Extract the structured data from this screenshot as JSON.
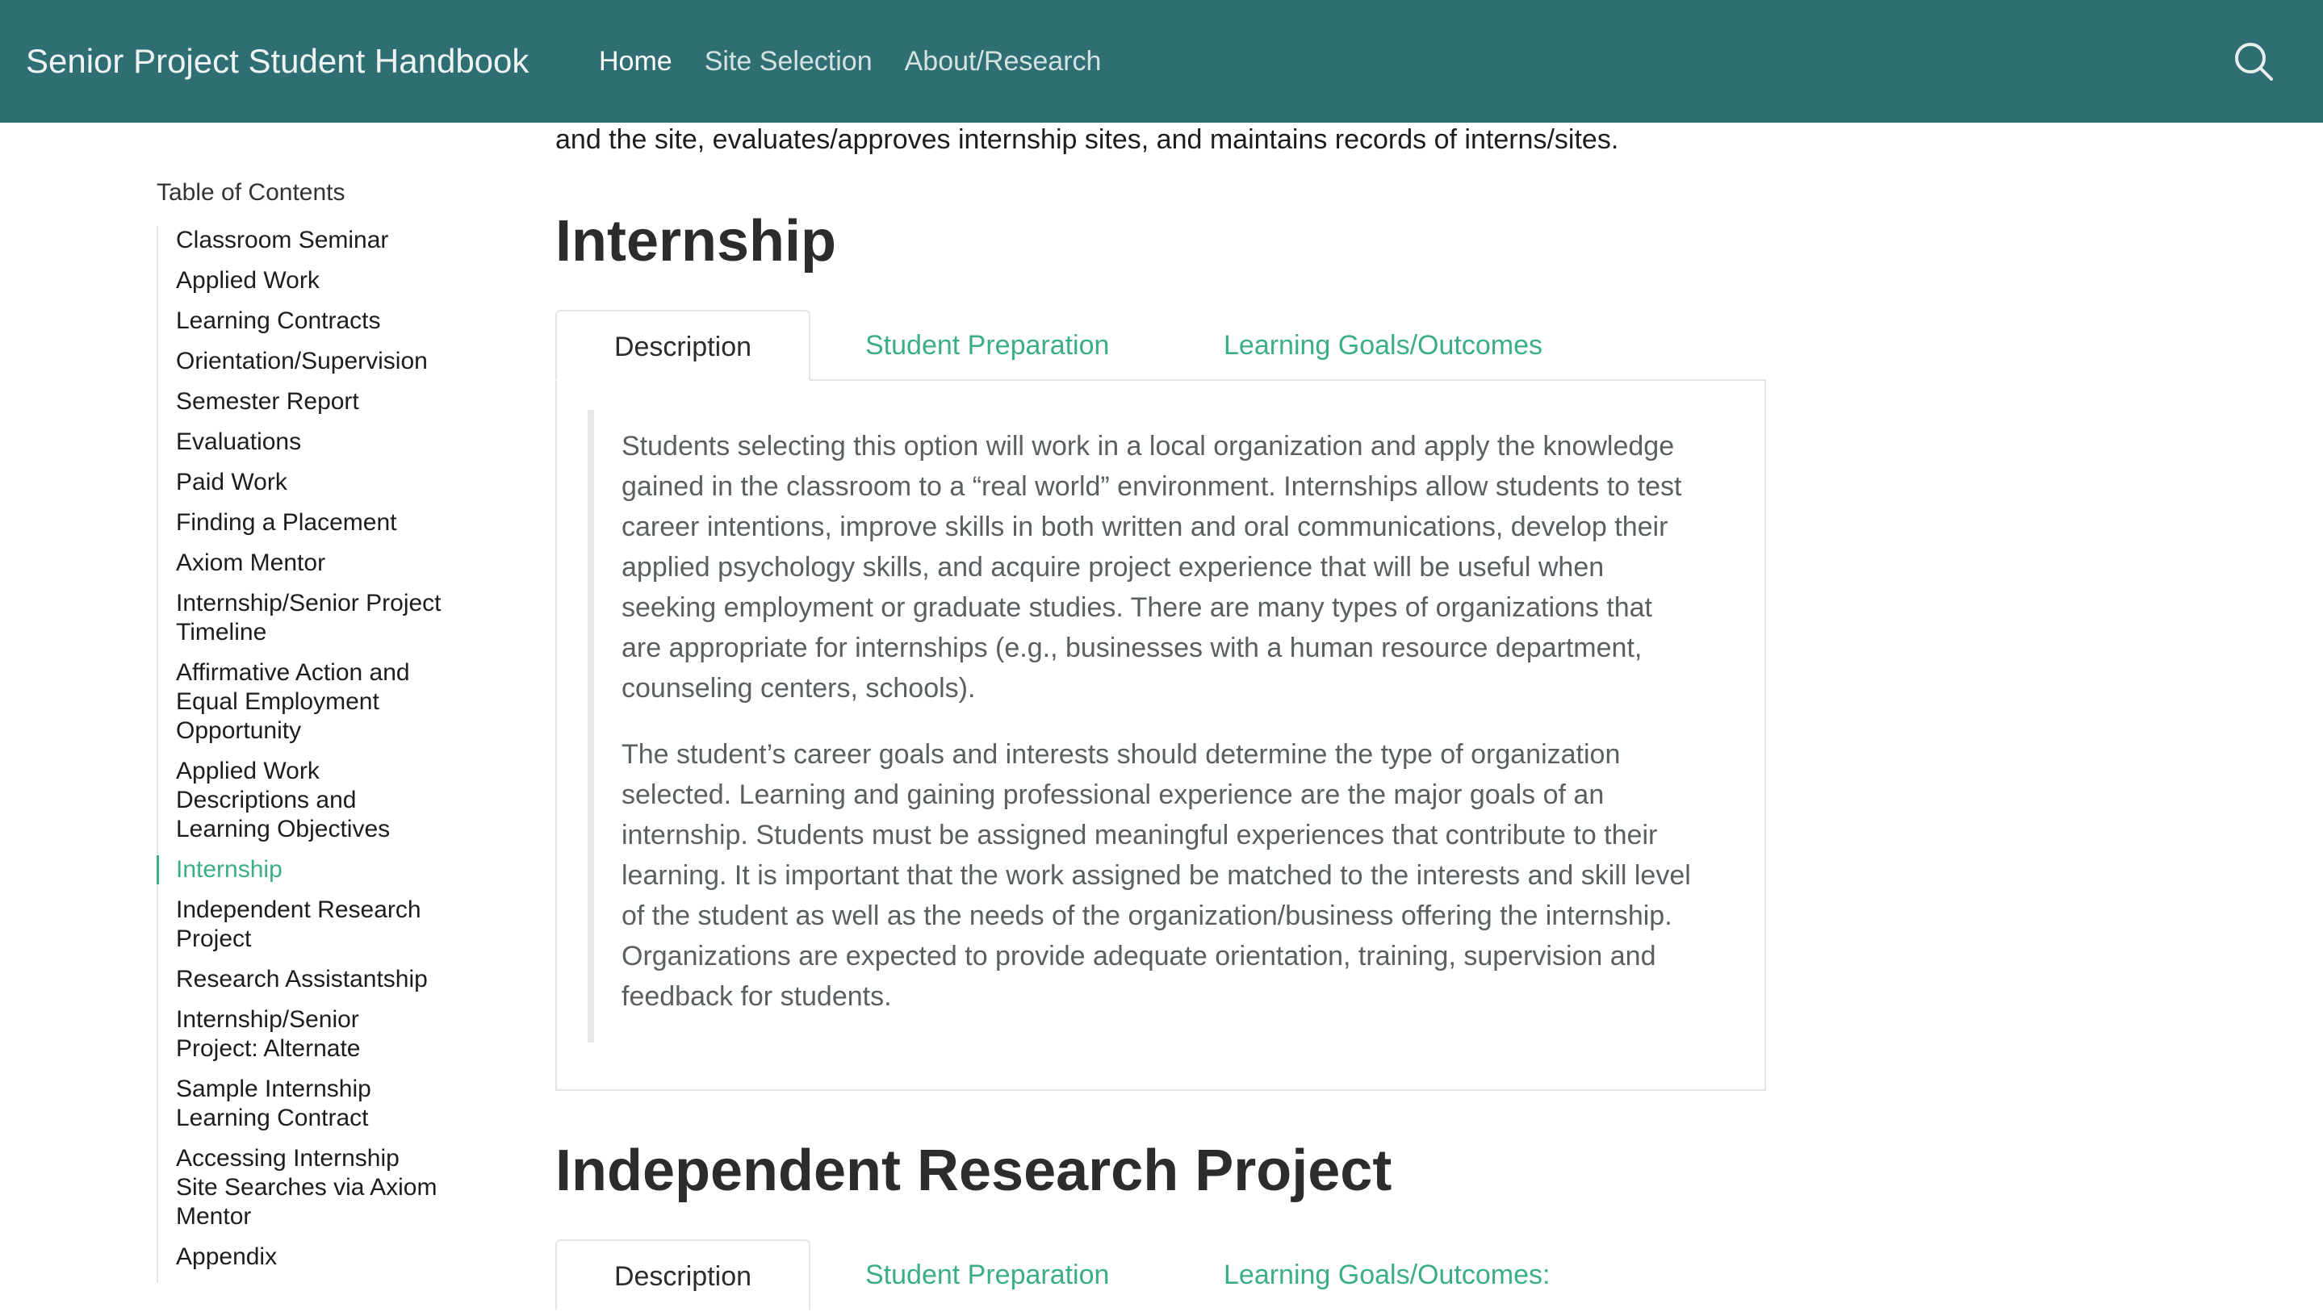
{
  "navbar": {
    "brand": "Senior Project Student Handbook",
    "links": [
      {
        "label": "Home"
      },
      {
        "label": "Site Selection"
      },
      {
        "label": "About/Research"
      }
    ],
    "search_icon": "search-icon",
    "colors": {
      "background": "#2f6e72",
      "accent": "#3cae86"
    }
  },
  "toc": {
    "title": "Table of Contents",
    "items": [
      {
        "label": "Classroom Seminar"
      },
      {
        "label": "Applied Work"
      },
      {
        "label": "Learning Contracts"
      },
      {
        "label": "Orientation/Supervision"
      },
      {
        "label": "Semester Report"
      },
      {
        "label": "Evaluations"
      },
      {
        "label": "Paid Work"
      },
      {
        "label": "Finding a Placement"
      },
      {
        "label": "Axiom Mentor"
      },
      {
        "label": "Internship/Senior Project Timeline"
      },
      {
        "label": "Affirmative Action and Equal Employment Opportunity"
      },
      {
        "label": "Applied Work Descriptions and Learning Objectives"
      },
      {
        "label": "Internship"
      },
      {
        "label": "Independent Research Project"
      },
      {
        "label": "Research Assistantship"
      },
      {
        "label": "Internship/Senior Project: Alternate"
      },
      {
        "label": "Sample Internship Learning Contract"
      },
      {
        "label": "Accessing Internship Site Searches via Axiom Mentor"
      },
      {
        "label": "Appendix"
      }
    ],
    "active_index": 12
  },
  "main": {
    "intro_line": "and the site, evaluates/approves internship sites, and maintains records of interns/sites.",
    "sections": [
      {
        "title": "Internship",
        "tabs": [
          {
            "label": "Description"
          },
          {
            "label": "Student Preparation"
          },
          {
            "label": "Learning Goals/Outcomes"
          }
        ],
        "paragraphs": [
          "Students selecting this option will work in a local organization and apply the knowledge gained in the classroom to a “real world” environment. Internships allow students to test career intentions, improve skills in both written and oral communications, develop their applied psychology skills, and acquire project experience that will be useful when seeking employment or graduate studies. There are many types of organizations that are appropriate for internships (e.g., businesses with a human resource department, counseling centers, schools).",
          "The student’s career goals and interests should determine the type of organization selected. Learning and gaining professional experience are the major goals of an internship. Students must be assigned meaningful experiences that contribute to their learning. It is important that the work assigned be matched to the interests and skill level of the student as well as the needs of the organization/business offering the internship. Organizations are expected to provide adequate orientation, training, supervision and feedback for students."
        ]
      },
      {
        "title": "Independent Research Project",
        "tabs": [
          {
            "label": "Description"
          },
          {
            "label": "Student Preparation"
          },
          {
            "label": "Learning Goals/Outcomes:"
          }
        ]
      }
    ]
  }
}
